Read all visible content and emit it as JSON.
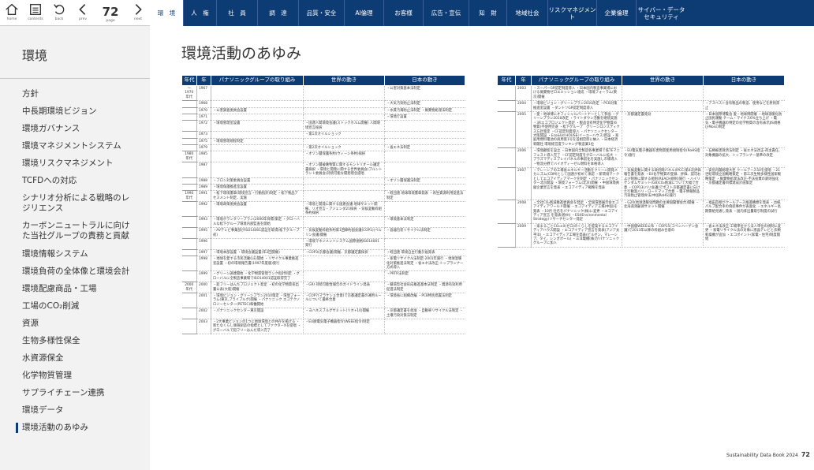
{
  "nav": {
    "home_label": "home",
    "contents_label": "contents",
    "back_label": "back",
    "prev_label": "prev",
    "page_number": "72",
    "page_label": "page",
    "next_label": "next"
  },
  "tabs": [
    "環　境",
    "人　権",
    "社　員",
    "調　達",
    "品質・安全",
    "AI倫理",
    "お客様",
    "広告・宣伝",
    "知　財",
    "地域社会",
    "リスクマネジメント",
    "企業倫理",
    "サイバー・データセキュリティ"
  ],
  "sidebar": {
    "title": "環境",
    "items": [
      "方針",
      "中長期環境ビジョン",
      "環境ガバナンス",
      "環境マネジメントシステム",
      "環境リスクマネジメント",
      "TCFDへの対応",
      "シナリオ分析による戦略のレジリエンス",
      "カーボンニュートラルに向けた当社グループの責務と貢献",
      "環境情報システム",
      "環境負荷の全体像と環境会計",
      "環境配慮商品・工場",
      "工場のCO₂削減",
      "資源",
      "生物多様性保全",
      "水資源保全",
      "化学物質管理",
      "サプライチェーン連携",
      "環境データ",
      "環境活動のあゆみ"
    ]
  },
  "page": {
    "title": "環境活動のあゆみ"
  },
  "table_headers": {
    "era": "年代",
    "year": "年",
    "panasonic": "パナソニックグループの取り組み",
    "world": "世界の動き",
    "japan": "日本の動き"
  },
  "left_rows": [
    {
      "era": "〜1970年代",
      "year": "1967",
      "p": "",
      "w": "",
      "j": "・公害対策基本法制定"
    },
    {
      "era": "",
      "year": "1968",
      "p": "",
      "w": "",
      "j": "・大気汚染防止法制定"
    },
    {
      "era": "",
      "year": "1970",
      "p": "・公害調査委員会設置",
      "w": "",
      "j": "・水質汚濁防止法制定 ・廃棄物処理法制定"
    },
    {
      "era": "",
      "year": "1971",
      "p": "",
      "w": "",
      "j": "・環境庁設置"
    },
    {
      "era": "",
      "year": "1972",
      "p": "・環境管理室設置",
      "w": "・国連人間環境会議(ストックホルム開催) 人間環境宣言採択",
      "j": ""
    },
    {
      "era": "",
      "year": "1973",
      "p": "",
      "w": "・第1次オイルショック",
      "j": ""
    },
    {
      "era": "",
      "year": "1975",
      "p": "・環境管理規程制定",
      "w": "",
      "j": ""
    },
    {
      "era": "",
      "year": "1979",
      "p": "",
      "w": "・第2次オイルショック",
      "j": "・省エネ法制定"
    },
    {
      "era": "1980年代",
      "year": "1985",
      "p": "",
      "w": "・オゾン層保護条約(ウィーン条約)採択",
      "j": ""
    },
    {
      "era": "",
      "year": "1987",
      "p": "",
      "w": "・オゾン層破壊物質に関するモントリオール議定書採択 ・環境と開発に関する世界委員会(ブルントラント委員会)持続可能な開発理念提唱",
      "j": ""
    },
    {
      "era": "",
      "year": "1988",
      "p": "・フロン対策委員会設置",
      "w": "",
      "j": "・オゾン層保護法制定"
    },
    {
      "era": "",
      "year": "1989",
      "p": "・環境保護推進室設置",
      "w": "",
      "j": ""
    },
    {
      "era": "1990年代",
      "year": "1991",
      "p": "・松下環境憲章(環境宣言・行動指針)制定 ・松下製品アセスメント制定、実施",
      "w": "",
      "j": "・経団連 地球環境憲章発表 ・再生資源利用促進法制定"
    },
    {
      "era": "",
      "year": "1992",
      "p": "・環境政策委員会設置",
      "w": "・環境と開発に関する国連会議 地球サミット開催、リオ宣言・アジェンダ21採択 ・気候変動枠組条約採択",
      "j": ""
    },
    {
      "era": "",
      "year": "1993",
      "p": "・環境ボランタリープラン(2000年目標)策定 ・グローバルな松下グループ環境内部監査を開始",
      "w": "",
      "j": "・環境基本法制定"
    },
    {
      "era": "",
      "year": "1995",
      "p": "・AVテレビ事業部がISO14001認証を取得(松下グループ初)",
      "w": "・気候変動枠組条約第1回締約国会議(COP1)(ベルリン会議)開催",
      "j": "・容器包装リサイクル法制定"
    },
    {
      "era": "",
      "year": "1996",
      "p": "",
      "w": "・環境マネジメントシステム国際規格ISO14001発行",
      "j": ""
    },
    {
      "era": "",
      "year": "1997",
      "p": "・環境本部設置 ・環境会議設置(年2回開催)",
      "w": "・COP3(京都会議)開催、京都議定書採択",
      "j": "・経団連 環境自主行動計画発表"
    },
    {
      "era": "",
      "year": "1998",
      "p": "・地球を愛する市民活動(LE)開始 ・リサイクル事業推進室設置 ・初の環境報告書(1997年度版)発行",
      "w": "",
      "j": "・家電リサイクル法制定-2001年施行 ・地球温暖化対策推進法制定 ・省エネ法改正-トップランナー方式導入"
    },
    {
      "era": "",
      "year": "1999",
      "p": "・グリーン調達開始 ・化学物質管理ランク指針制定 ・グローバルに全製造事業場でISO14001認証取得完了",
      "w": "",
      "j": "・PRTR法制定"
    },
    {
      "era": "2000年代",
      "year": "2000",
      "p": "・鉛フリーはんだプロジェクト発足 ・初の化学物質排出量公表(大阪)開催",
      "w": "・GRI 持続可能性報告のガイドライン発表",
      "j": "・循環型社会形成推進基本法制定 ・資源有効利用促進法制定"
    },
    {
      "era": "",
      "year": "2001",
      "p": "・環境ビジョン・グリーンプラン2010策定 ・環境フォーラム(東京,フライブルグ)開催 ・パナソニック エコテクノロジーセンター(PETEC)稼働開始",
      "w": "・COP7(マラケシュ合意)で京都議定書の運用ルールについて最終合意",
      "j": "・環境省に組織改編 ・PCB特別措置法制定"
    },
    {
      "era": "",
      "year": "2002",
      "p": "・パナソニックセンター東京開設",
      "w": "・ヨハネスブルグサミット(リオ+10)開催",
      "j": "・京都議定書を批准 ・自動車リサイクル法制定 ・土壌汚染対策法制定"
    },
    {
      "era": "",
      "year": "2003",
      "p": "・2大事業ビジョンの1つに地球環境との共存を掲げる ・新たなくらし価値創造の指標としてファクターXを提唱 ・グローバルで鉛フリーはんだ導入完了",
      "w": "・EU廃電気電子機器指令(WEEE指令)制定",
      "j": ""
    }
  ],
  "right_rows": [
    {
      "era": "",
      "year": "2003",
      "p": "・スーパーGP認定制度導入 ・日本国内製造事業場における廃棄物ゼロエミッション達成 ・環境フォーラム(東京)開催",
      "w": "",
      "j": ""
    },
    {
      "era": "",
      "year": "2004",
      "p": "・環境ビジョン・グリーンプラン2010改定 ・PCB対策推進室設置 ・ダントツGP認定制度導入",
      "w": "",
      "j": "・アスベスト含有製品の製造、使用などを原則禁止"
    },
    {
      "era": "",
      "year": "2005",
      "p": "・愛・地球博にオフィシャルパートナーとして参画 ・グリーンプラン2010改定 ・ライトダウン活動を継続実施 ・3Rエコプロジェクト発足 ・製品含有特定化学物質(6物質)不使用完遂 ・松下グループ　グリーンロジスティクス方針策定 ・CF認定制度導入 ・パナソニックセンター大阪開設 ・Eco&Ud HOUSE(イーユーハウス)新設 ・家庭用燃料電池の商用第1号を首相官邸に納入 ・日本経済新聞社 環境経営度ランキング製造業1位",
      "w": "・京都議定書発効",
      "j": "・日本国際博覧会 愛・地球博開催 ・地球温暖化防止国民運動 チーム・マイナス6%立ち上げ ・電気・電子機器の特定の化学物質の含有表示JIS規格(J-Moss)制定"
    },
    {
      "era": "",
      "year": "2006",
      "p": "・環境顧客を設立 ・日本国内全製造各事業場で低TEマニフェスト導入完了 ・CF認定制度をグローバルに拡大 ・プラズマディスプレイパネルの事前化を実施し市場導入 ・物流分野でバイオディーゼル燃料を本格導入",
      "w": "・EU電気電子機器有害物質使用規制指令(RoHS指令)施行",
      "j": "・石綿被害救済法制定 ・省エネ法改正-荷主責任、対象機器の拡大、トップランナー基準の改定"
    },
    {
      "era": "",
      "year": "2007",
      "p": "・マレーシアの工場省エネルギー活動をクリーン開発メカニズム(CDM)として国連が初めて承認 ・新環境マークとしてエコアイディアマークを制定 ・パナソニックセンター北京開設 ・環境フォーラム(北京)開催 ・中国環境貢献企業宣言を発表 ・エコアイディア戦略を発表",
      "w": "・気候変動に関する政府間パネル(IPCC)第4次評価報告書を発表 ・EU化学物質の登録、評価、認可および制限に関する規則(REACH規則)施行 ・ハイリゲンダムサミット(G8)CO₂削減について大幅で合意 ・COP13(バリ会議)でポスト京都議定書に向けた行動案バリ・ロードマップ合意 ・電子情報製品汚染防止管理弁法(中国RoHS)施行",
      "j": "・安倍内閣総理大臣 クールアース50を提唱 ・21世紀環境立国戦略策定 ・第三次生物多様性国家戦略策定 ・廃棄物処理法改正-不法投棄の罰則強化 ・京都議定書目標達成計画策定"
    },
    {
      "era": "",
      "year": "2008",
      "p": "・全社CO₂削減推進委員会を発足 ・全国環境展示会エコアイディアワールド開催 ・エコアイディア工場(中国)を発表 ・10月 社名をパナソニック(株)に変更 ・エコアイディア宣言 を発表(欧州) ・ESI(Environmental Strategy)リサーチセンター発足",
      "w": "・G20(地球温暖化問題の主要国閣僚会合)開催 ・北海道洞爺湖サミット開催",
      "j": "・福田首相がクールアース推進構想を発表 ・古紙パルプ配合率の偽装事件が表面化 ・エネルギー長期需給見通し発表 ・国内排出量取引制度の試行"
    },
    {
      "era": "",
      "year": "2009",
      "p": "・家まるごとCO₂±0(ゼロ)のくらしを提案するエコアイディアハウス開設 ・エコアイディア宣言を発表(アジア太平洋) ・エコアイディア工場を発表(ピルゼン、マレーシア、タイ、シンガポール) ・三洋電機(株)がパナソニックグループに加入",
      "w": "・中国版WEEE公布 ・COP15(コペンハーゲン会議)で2013年以降の枠組み合意の",
      "j": "・省エネ法改正-工場単位から法人単位の規制に変更 ・家電リサイクル法の対象に液晶テレビと衣類乾燥機が追加 ・エコポイント(家電・住宅)制度開始"
    }
  ],
  "footer": {
    "book": "Sustainability Data Book 2024",
    "page": "72"
  }
}
